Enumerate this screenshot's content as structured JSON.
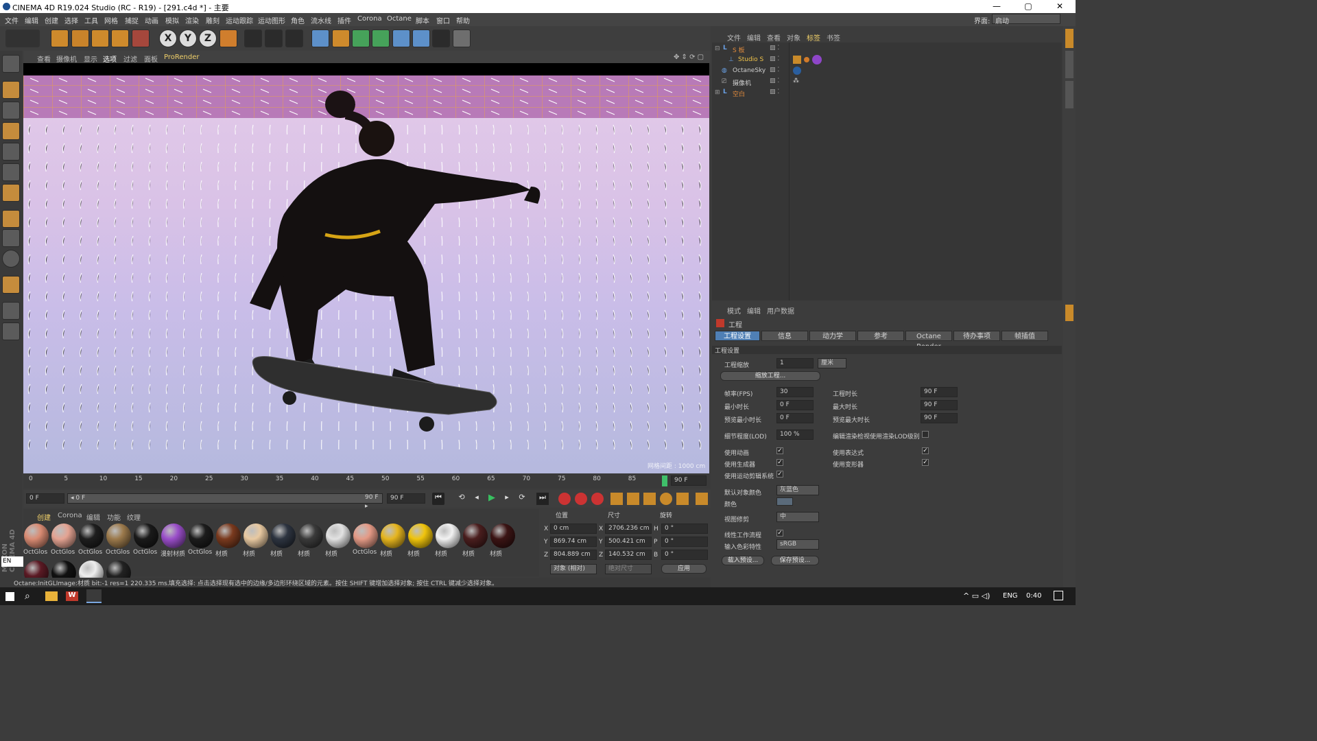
{
  "window": {
    "title": "CINEMA 4D R19.024 Studio (RC - R19) - [291.c4d *] - 主要",
    "min": "—",
    "max": "▢",
    "close": "✕"
  },
  "menubar": {
    "items": [
      "文件",
      "编辑",
      "创建",
      "选择",
      "工具",
      "网格",
      "捕捉",
      "动画",
      "模拟",
      "渲染",
      "雕刻",
      "运动跟踪",
      "运动图形",
      "角色",
      "流水线",
      "插件",
      "Corona",
      "Octane",
      "脚本",
      "窗口",
      "帮助"
    ],
    "layout_label": "界面:",
    "layout_value": "启动"
  },
  "viewport": {
    "menus": [
      "查看",
      "摄像机",
      "显示",
      "选项",
      "过滤",
      "面板",
      "ProRender"
    ],
    "grid_note": "网格间距 : 1000 cm"
  },
  "timeline": {
    "ticks": [
      "0",
      "5",
      "10",
      "15",
      "20",
      "25",
      "30",
      "35",
      "40",
      "45",
      "50",
      "55",
      "60",
      "65",
      "70",
      "75",
      "80",
      "85"
    ],
    "end_label": "90 F",
    "current_frame": "0 F",
    "range_start": "◂ 0 F",
    "range_end": "90 F ▸",
    "max_frame": "90 F"
  },
  "materials": {
    "menus": [
      "创建",
      "Corona",
      "编辑",
      "功能",
      "纹理"
    ],
    "items": [
      {
        "label": "OctGlos",
        "color": "#d98b73"
      },
      {
        "label": "OctGlos",
        "color": "#e4a392"
      },
      {
        "label": "OctGlos",
        "color": "#1e1e1e"
      },
      {
        "label": "OctGlos",
        "color": "#9c7a4c"
      },
      {
        "label": "OctGlos",
        "color": "#1a1a1a"
      },
      {
        "label": "漫射材质",
        "color": "#9a4ec9"
      },
      {
        "label": "OctGlos",
        "color": "#1c1c1c"
      },
      {
        "label": "材质",
        "color": "#7a3a1e"
      },
      {
        "label": "材质",
        "color": "#e8c9a1"
      },
      {
        "label": "材质",
        "color": "#2d3440"
      },
      {
        "label": "材质",
        "color": "#3a3a3a"
      },
      {
        "label": "材质",
        "color": "#e2e2e2"
      },
      {
        "label": "OctGlos",
        "color": "#e49a86"
      },
      {
        "label": "材质",
        "color": "#e6b51e"
      },
      {
        "label": "材质",
        "color": "#f0c40c"
      },
      {
        "label": "材质",
        "color": "#f2f2f2"
      },
      {
        "label": "材质",
        "color": "#4a1e1e"
      },
      {
        "label": "材质",
        "color": "#3b1414"
      },
      {
        "label": "",
        "color": "#5b1a24"
      },
      {
        "label": "",
        "color": "#111111"
      },
      {
        "label": "",
        "color": "#eeeeee"
      },
      {
        "label": "",
        "color": "#222222"
      }
    ]
  },
  "coords": {
    "headers": [
      "位置",
      "尺寸",
      "旋转"
    ],
    "rows": [
      {
        "axis": "X",
        "pos": "0 cm",
        "size_axis": "X",
        "size": "2706.236 cm",
        "rot_axis": "H",
        "rot": "0 °"
      },
      {
        "axis": "Y",
        "pos": "869.74 cm",
        "size_axis": "Y",
        "size": "500.421 cm",
        "rot_axis": "P",
        "rot": "0 °"
      },
      {
        "axis": "Z",
        "pos": "804.889 cm",
        "size_axis": "Z",
        "size": "140.532 cm",
        "rot_axis": "B",
        "rot": "0 °"
      }
    ],
    "mode": "对象 (相对)",
    "size_mode": "绝对尺寸",
    "apply": "应用"
  },
  "status": {
    "left": "Octane:InitGLImage:材质  bit:-1 res=1  220.335 ms.",
    "hint": "填充选择: 点击选择现有选中的边缘/多边形环绕区域的元素。按住 SHIFT 键增加选择对象; 按住 CTRL 键减少选择对象。"
  },
  "objects": {
    "menus": [
      "文件",
      "编辑",
      "查看",
      "对象",
      "标签",
      "书签"
    ],
    "items": [
      {
        "name": "S 板",
        "indent": 0
      },
      {
        "name": "Studio S",
        "indent": 1
      },
      {
        "name": "OctaneSky",
        "indent": 0
      },
      {
        "name": "摄像机",
        "indent": 0
      },
      {
        "name": "空白",
        "indent": 0
      }
    ]
  },
  "attributes": {
    "menus": [
      "模式",
      "编辑",
      "用户数据"
    ],
    "section": "工程",
    "tabs": [
      "工程设置",
      "信息",
      "动力学",
      "参考",
      "Octane Render",
      "待办事项",
      "帧插值"
    ],
    "group": "工程设置",
    "scale_label": "工程缩放",
    "scale_value": "1",
    "scale_unit": "厘米",
    "scale_btn": "缩放工程...",
    "fps_label": "帧率(FPS)",
    "fps": "30",
    "proj_len_label": "工程时长",
    "proj_len": "90 F",
    "min_len_label": "最小时长",
    "min_len": "0 F",
    "max_len_label": "最大时长",
    "max_len": "90 F",
    "prev_min_label": "预览最小时长",
    "prev_min": "0 F",
    "prev_max_label": "预览最大时长",
    "prev_max": "90 F",
    "lod_label": "细节程度(LOD)",
    "lod": "100 %",
    "lod_render_label": "编辑渲染检视使用渲染LOD级别",
    "use_anim": "使用动画",
    "use_expr": "使用表达式",
    "use_gen": "使用生成器",
    "use_deform": "使用变形器",
    "use_motion": "使用运动剪辑系统",
    "obj_color_label": "默认对象颜色",
    "obj_color": "灰蓝色",
    "color_label": "颜色",
    "view_clip_label": "视图修剪",
    "view_clip": "中",
    "linear_label": "线性工作流程",
    "input_color_label": "输入色彩特性",
    "input_color": "sRGB",
    "load_preset": "载入预设...",
    "save_preset": "保存预设..."
  },
  "taskbar": {
    "lang": "ENG",
    "time": "0:40",
    "ime": "EN"
  }
}
